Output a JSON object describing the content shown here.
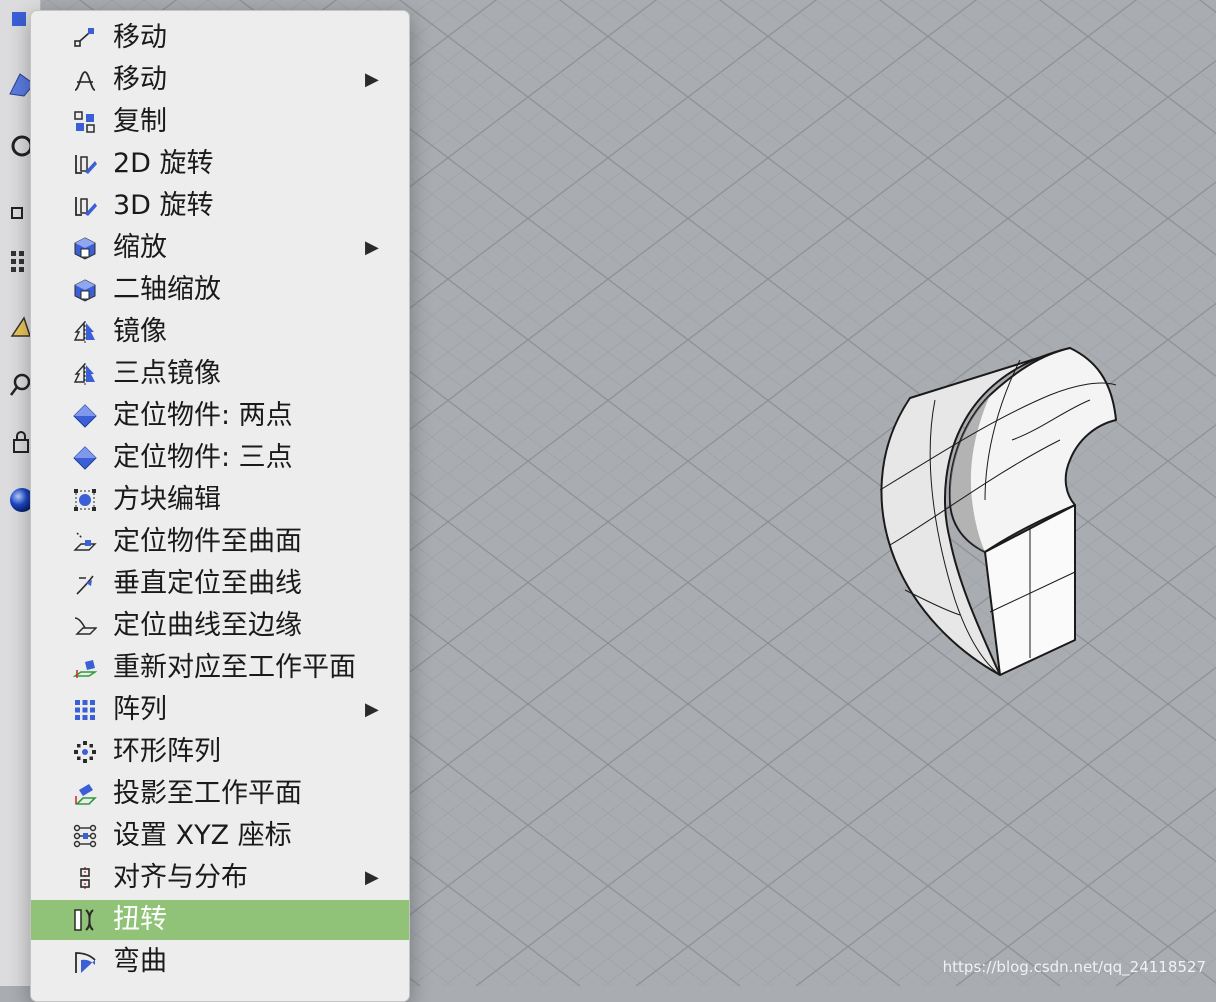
{
  "menu": {
    "items": [
      {
        "label": "移动",
        "icon": "move-icon",
        "submenu": false,
        "highlighted": false
      },
      {
        "label": "移动",
        "icon": "move-curve-icon",
        "submenu": true,
        "highlighted": false
      },
      {
        "label": "复制",
        "icon": "copy-icon",
        "submenu": false,
        "highlighted": false
      },
      {
        "label": "2D 旋转",
        "icon": "rotate-2d-icon",
        "submenu": false,
        "highlighted": false
      },
      {
        "label": "3D 旋转",
        "icon": "rotate-3d-icon",
        "submenu": false,
        "highlighted": false
      },
      {
        "label": "缩放",
        "icon": "scale-icon",
        "submenu": true,
        "highlighted": false
      },
      {
        "label": "二轴缩放",
        "icon": "scale-2d-icon",
        "submenu": false,
        "highlighted": false
      },
      {
        "label": "镜像",
        "icon": "mirror-icon",
        "submenu": false,
        "highlighted": false
      },
      {
        "label": "三点镜像",
        "icon": "mirror-3pt-icon",
        "submenu": false,
        "highlighted": false
      },
      {
        "label": "定位物件: 两点",
        "icon": "orient-2pt-icon",
        "submenu": false,
        "highlighted": false
      },
      {
        "label": "定位物件: 三点",
        "icon": "orient-3pt-icon",
        "submenu": false,
        "highlighted": false
      },
      {
        "label": "方块编辑",
        "icon": "box-edit-icon",
        "submenu": false,
        "highlighted": false
      },
      {
        "label": "定位物件至曲面",
        "icon": "orient-on-surface-icon",
        "submenu": false,
        "highlighted": false
      },
      {
        "label": "垂直定位至曲线",
        "icon": "orient-perp-curve-icon",
        "submenu": false,
        "highlighted": false
      },
      {
        "label": "定位曲线至边缘",
        "icon": "orient-curve-edge-icon",
        "submenu": false,
        "highlighted": false
      },
      {
        "label": "重新对应至工作平面",
        "icon": "remap-cplane-icon",
        "submenu": false,
        "highlighted": false
      },
      {
        "label": "阵列",
        "icon": "array-icon",
        "submenu": true,
        "highlighted": false
      },
      {
        "label": "环形阵列",
        "icon": "polar-array-icon",
        "submenu": false,
        "highlighted": false
      },
      {
        "label": "投影至工作平面",
        "icon": "project-cplane-icon",
        "submenu": false,
        "highlighted": false
      },
      {
        "label": "设置 XYZ 座标",
        "icon": "set-xyz-icon",
        "submenu": false,
        "highlighted": false
      },
      {
        "label": "对齐与分布",
        "icon": "align-icon",
        "submenu": true,
        "highlighted": false
      },
      {
        "label": "扭转",
        "icon": "twist-icon",
        "submenu": false,
        "highlighted": true
      },
      {
        "label": "弯曲",
        "icon": "bend-icon",
        "submenu": false,
        "highlighted": false
      }
    ],
    "submenu_arrow": "▶",
    "highlight_color": "#90c277"
  },
  "watermark": "https://blog.csdn.net/qq_24118527",
  "colors": {
    "viewport_bg": "#a9acb1",
    "grid_minor": "#9fa2a7",
    "grid_major": "#8e9196",
    "icon_blue": "#3b5fd6"
  }
}
